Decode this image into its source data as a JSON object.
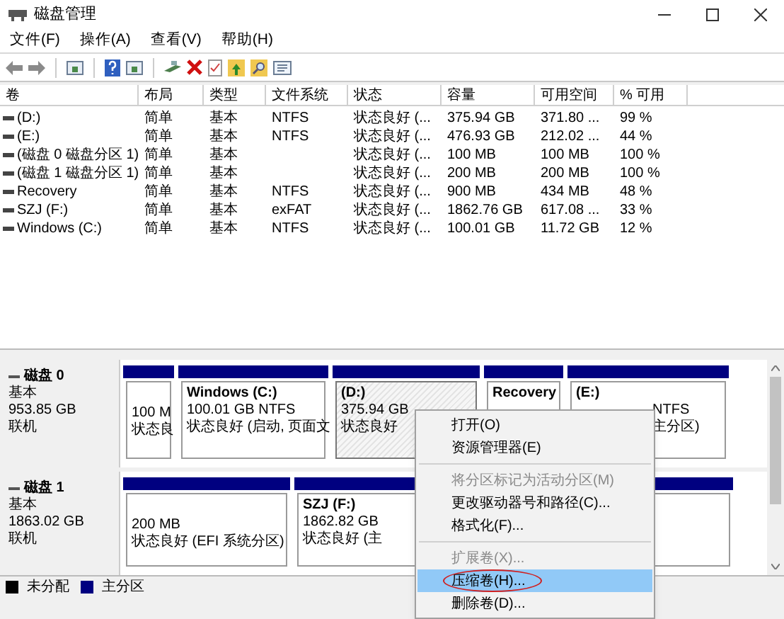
{
  "window": {
    "title": "磁盘管理"
  },
  "menu_bar": [
    "文件(F)",
    "操作(A)",
    "查看(V)",
    "帮助(H)"
  ],
  "table": {
    "columns": [
      "卷",
      "布局",
      "类型",
      "文件系统",
      "状态",
      "容量",
      "可用空间",
      "% 可用"
    ],
    "rows": [
      [
        "(D:)",
        "简单",
        "基本",
        "NTFS",
        "状态良好 (...",
        "375.94 GB",
        "371.80 ...",
        "99 %"
      ],
      [
        "(E:)",
        "简单",
        "基本",
        "NTFS",
        "状态良好 (...",
        "476.93 GB",
        "212.02 ...",
        "44 %"
      ],
      [
        "(磁盘 0 磁盘分区 1)",
        "简单",
        "基本",
        "",
        "状态良好 (...",
        "100 MB",
        "100 MB",
        "100 %"
      ],
      [
        "(磁盘 1 磁盘分区 1)",
        "简单",
        "基本",
        "",
        "状态良好 (...",
        "200 MB",
        "200 MB",
        "100 %"
      ],
      [
        "Recovery",
        "简单",
        "基本",
        "NTFS",
        "状态良好 (...",
        "900 MB",
        "434 MB",
        "48 %"
      ],
      [
        "SZJ (F:)",
        "简单",
        "基本",
        "exFAT",
        "状态良好 (...",
        "1862.76 GB",
        "617.08 ...",
        "33 %"
      ],
      [
        "Windows (C:)",
        "简单",
        "基本",
        "NTFS",
        "状态良好 (...",
        "100.01 GB",
        "11.72 GB",
        "12 %"
      ]
    ]
  },
  "disks": [
    {
      "name": "磁盘 0",
      "type": "基本",
      "size": "953.85 GB",
      "status": "联机",
      "partitions": [
        {
          "lines": [
            "100 M",
            "状态良"
          ],
          "selected": false
        },
        {
          "title": "Windows  (C:)",
          "lines": [
            "100.01 GB NTFS",
            "状态良好 (启动, 页面文"
          ],
          "selected": false
        },
        {
          "title": "(D:)",
          "lines": [
            "375.94 GB",
            "状态良好"
          ],
          "selected": true
        },
        {
          "title": "Recovery",
          "selected": false
        },
        {
          "title": "(E:)",
          "lines": [
            "NTFS",
            "主分区)"
          ],
          "selected": false
        }
      ]
    },
    {
      "name": "磁盘 1",
      "type": "基本",
      "size": "1863.02 GB",
      "status": "联机",
      "partitions": [
        {
          "lines": [
            "200 MB",
            "状态良好 (EFI 系统分区)"
          ],
          "selected": false
        },
        {
          "title": "SZJ  (F:)",
          "lines": [
            "1862.82 GB",
            "状态良好 (主"
          ],
          "selected": false
        }
      ]
    }
  ],
  "legend": [
    {
      "label": "未分配",
      "color": "#000000"
    },
    {
      "label": "主分区",
      "color": "#000080"
    }
  ],
  "context_menu": [
    {
      "kind": "item",
      "label": "打开(O)",
      "disabled": false,
      "selected": false
    },
    {
      "kind": "item",
      "label": "资源管理器(E)",
      "disabled": false,
      "selected": false
    },
    {
      "kind": "separator"
    },
    {
      "kind": "item",
      "label": "将分区标记为活动分区(M)",
      "disabled": true,
      "selected": false
    },
    {
      "kind": "item",
      "label": "更改驱动器号和路径(C)...",
      "disabled": false,
      "selected": false
    },
    {
      "kind": "item",
      "label": "格式化(F)...",
      "disabled": false,
      "selected": false
    },
    {
      "kind": "separator"
    },
    {
      "kind": "item",
      "label": "扩展卷(X)...",
      "disabled": true,
      "selected": false
    },
    {
      "kind": "item",
      "label": "压缩卷(H)...",
      "disabled": false,
      "selected": true,
      "circled": true
    },
    {
      "kind": "item",
      "label": "删除卷(D)...",
      "disabled": false,
      "selected": false
    }
  ]
}
